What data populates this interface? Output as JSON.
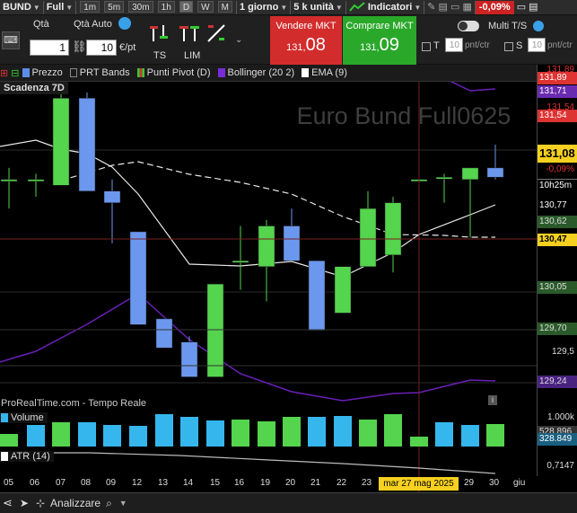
{
  "toolbar": {
    "instrument": "BUND",
    "mode": "Full",
    "timeframes": [
      "1m",
      "5m",
      "30m",
      "1h",
      "D",
      "W",
      "M"
    ],
    "selected_timeframe": "D",
    "period": "1 giorno",
    "units": "5 k unità",
    "indicators_label": "Indicatori",
    "change": "-0,09%"
  },
  "order": {
    "qty_label": "Qtà",
    "qty_auto_label": "Qtà Auto",
    "qty_value": "1",
    "lot_value": "10",
    "per_pt_label": "€/pt",
    "ts_label": "TS",
    "lim_label": "LIM",
    "sell_label": "Vendere MKT",
    "sell_price_small": "131,",
    "sell_price_big": "08",
    "buy_label": "Comprare MKT",
    "buy_price_small": "131,",
    "buy_price_big": "09",
    "multi_label": "Multi T/S",
    "t_label": "T",
    "s_label": "S",
    "pnt_value": "10",
    "pnt_unit": "pnt/ctr"
  },
  "indicators": {
    "price": "Prezzo",
    "prt": "PRT Bands",
    "pivot": "Punti Pivot (D)",
    "bollinger": "Bollinger (20 2)",
    "ema": "EMA (9)"
  },
  "chart": {
    "expiry": "Scadenza 7D",
    "watermark": "Euro Bund Full0625",
    "source": "ProRealTime.com - Tempo Reale",
    "volume_label": "Volume",
    "atr_label": "ATR (14)"
  },
  "axis": {
    "labels": [
      "131,89",
      "131,71",
      "131,54",
      "131,08",
      "-0,09%",
      "130,97",
      "10h25m",
      "130,91",
      "130,77",
      "130,62",
      "130,62",
      "130,47",
      "130,05",
      "130,05",
      "129,70",
      "129,70",
      "129,5",
      "129,24",
      "129,24"
    ],
    "vol_labels": [
      "1.000k",
      "528.896",
      "328.849"
    ],
    "atr_labels": [
      "0,7147"
    ]
  },
  "dates": [
    "05",
    "06",
    "07",
    "08",
    "09",
    "12",
    "13",
    "14",
    "15",
    "16",
    "19",
    "20",
    "21",
    "22",
    "23",
    "mar 27 mag 2025",
    "29",
    "30",
    "giu"
  ],
  "bottom": {
    "analyze": "Analizzare"
  },
  "chart_data": {
    "type": "candlestick",
    "candles": [
      {
        "o": 130.95,
        "h": 131.05,
        "l": 130.7,
        "c": 130.95
      },
      {
        "o": 130.95,
        "h": 131.0,
        "l": 130.8,
        "c": 130.95
      },
      {
        "o": 130.9,
        "h": 131.8,
        "l": 130.9,
        "c": 131.65
      },
      {
        "o": 131.65,
        "h": 131.7,
        "l": 130.85,
        "c": 130.85
      },
      {
        "o": 130.85,
        "h": 130.95,
        "l": 130.4,
        "c": 130.75
      },
      {
        "o": 130.5,
        "h": 130.5,
        "l": 129.7,
        "c": 129.7
      },
      {
        "o": 129.75,
        "h": 129.75,
        "l": 129.5,
        "c": 129.5
      },
      {
        "o": 129.55,
        "h": 129.6,
        "l": 129.25,
        "c": 129.25
      },
      {
        "o": 129.25,
        "h": 130.05,
        "l": 129.25,
        "c": 130.05
      },
      {
        "o": 130.25,
        "h": 130.55,
        "l": 130.0,
        "c": 130.25
      },
      {
        "o": 130.2,
        "h": 130.6,
        "l": 129.9,
        "c": 130.55
      },
      {
        "o": 130.55,
        "h": 130.7,
        "l": 130.25,
        "c": 130.25
      },
      {
        "o": 130.25,
        "h": 130.25,
        "l": 129.65,
        "c": 129.65
      },
      {
        "o": 129.8,
        "h": 130.2,
        "l": 129.8,
        "c": 130.2
      },
      {
        "o": 130.2,
        "h": 130.85,
        "l": 130.2,
        "c": 130.7
      },
      {
        "o": 130.3,
        "h": 130.8,
        "l": 130.15,
        "c": 130.75
      },
      {
        "o": 130.95,
        "h": 131.1,
        "l": 130.75,
        "c": 130.95
      },
      {
        "o": 130.97,
        "h": 131.0,
        "l": 130.75,
        "c": 130.97
      },
      {
        "o": 130.95,
        "h": 131.05,
        "l": 130.45,
        "c": 131.05
      },
      {
        "o": 131.05,
        "h": 131.25,
        "l": 130.95,
        "c": 130.97
      }
    ]
  }
}
